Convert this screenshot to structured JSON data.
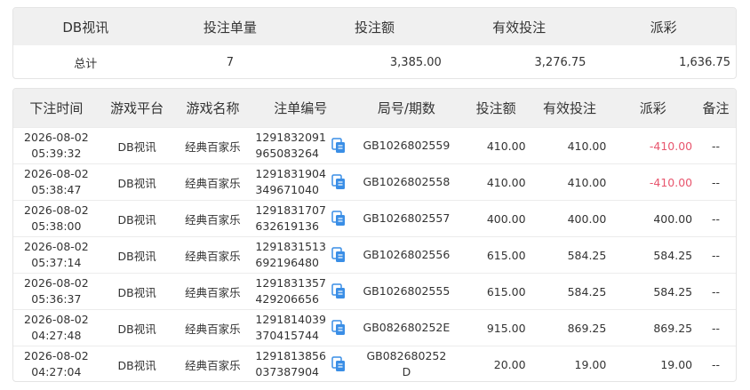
{
  "summary": {
    "headers": [
      "DB视讯",
      "投注单量",
      "投注额",
      "有效投注",
      "派彩"
    ],
    "total_label": "总计",
    "bet_count": "7",
    "bet_amount": "3,385.00",
    "valid_bet": "3,276.75",
    "payout": "1,636.75"
  },
  "table": {
    "headers": {
      "time": "下注时间",
      "platform": "游戏平台",
      "game": "游戏名称",
      "order": "注单编号",
      "round": "局号/期数",
      "bet": "投注额",
      "valid": "有效投注",
      "payout": "派彩",
      "note": "备注"
    },
    "rows": [
      {
        "date": "2026-08-02",
        "time": "05:39:32",
        "platform": "DB视讯",
        "game": "经典百家乐",
        "order1": "1291832091",
        "order2": "965083264",
        "round1": "GB1026802559",
        "round2": "",
        "bet": "410.00",
        "valid": "410.00",
        "payout": "-410.00",
        "note": "--"
      },
      {
        "date": "2026-08-02",
        "time": "05:38:47",
        "platform": "DB视讯",
        "game": "经典百家乐",
        "order1": "1291831904",
        "order2": "349671040",
        "round1": "GB1026802558",
        "round2": "",
        "bet": "410.00",
        "valid": "410.00",
        "payout": "-410.00",
        "note": "--"
      },
      {
        "date": "2026-08-02",
        "time": "05:38:00",
        "platform": "DB视讯",
        "game": "经典百家乐",
        "order1": "1291831707",
        "order2": "632619136",
        "round1": "GB1026802557",
        "round2": "",
        "bet": "400.00",
        "valid": "400.00",
        "payout": "400.00",
        "note": "--"
      },
      {
        "date": "2026-08-02",
        "time": "05:37:14",
        "platform": "DB视讯",
        "game": "经典百家乐",
        "order1": "1291831513",
        "order2": "692196480",
        "round1": "GB1026802556",
        "round2": "",
        "bet": "615.00",
        "valid": "584.25",
        "payout": "584.25",
        "note": "--"
      },
      {
        "date": "2026-08-02",
        "time": "05:36:37",
        "platform": "DB视讯",
        "game": "经典百家乐",
        "order1": "1291831357",
        "order2": "429206656",
        "round1": "GB1026802555",
        "round2": "",
        "bet": "615.00",
        "valid": "584.25",
        "payout": "584.25",
        "note": "--"
      },
      {
        "date": "2026-08-02",
        "time": "04:27:48",
        "platform": "DB视讯",
        "game": "经典百家乐",
        "order1": "1291814039",
        "order2": "370415744",
        "round1": "GB082680252E",
        "round2": "",
        "bet": "915.00",
        "valid": "869.25",
        "payout": "869.25",
        "note": "--"
      },
      {
        "date": "2026-08-02",
        "time": "04:27:04",
        "platform": "DB视讯",
        "game": "经典百家乐",
        "order1": "1291813856",
        "order2": "037387904",
        "round1": "GB082680252",
        "round2": "D",
        "bet": "20.00",
        "valid": "19.00",
        "payout": "19.00",
        "note": "--"
      }
    ]
  },
  "colors": {
    "header_bg": "#f0f0f0",
    "negative": "#e8566e",
    "copy_icon": "#3a8ee6"
  },
  "icons": {
    "copy": "copy-icon"
  }
}
